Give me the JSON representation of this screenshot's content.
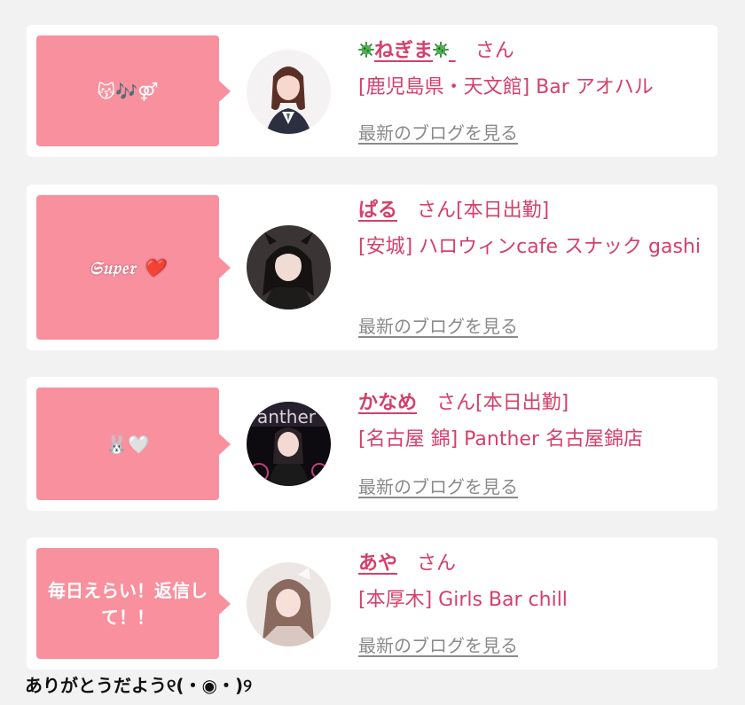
{
  "posts": [
    {
      "bubble": "😽🎶⚤",
      "name_prefix_icon": "virus-icon",
      "name": "ねぎま",
      "honorific": "さん",
      "status": "",
      "shop": "[鹿児島県・天文館] Bar アオハル",
      "blog_link": "最新のブログを見る"
    },
    {
      "bubble": "𝔖𝔲𝔭𝔢𝔯 ❤️",
      "name": "ぱる",
      "honorific": "さん",
      "status": "[本日出勤]",
      "shop": "[安城] ハロウィンcafe スナック gashi",
      "blog_link": "最新のブログを見る"
    },
    {
      "bubble": "🐰🤍",
      "name": "かなめ",
      "honorific": "さん",
      "status": "[本日出勤]",
      "shop": "[名古屋 錦] Panther 名古屋錦店",
      "blog_link": "最新のブログを見る"
    },
    {
      "bubble": "毎日えらい！返信して！！",
      "name": "あや",
      "honorific": "さん",
      "status": "",
      "shop": "[本厚木] Girls Bar chill",
      "blog_link": "最新のブログを見る"
    }
  ],
  "footer_caption": "ありがとうだよう୧(・◉・)୨",
  "colors": {
    "background": "#f2f2f3",
    "card": "#ffffff",
    "bubble": "#f8909e",
    "accent_text": "#d4406a",
    "muted_link": "#8a8a8a"
  }
}
